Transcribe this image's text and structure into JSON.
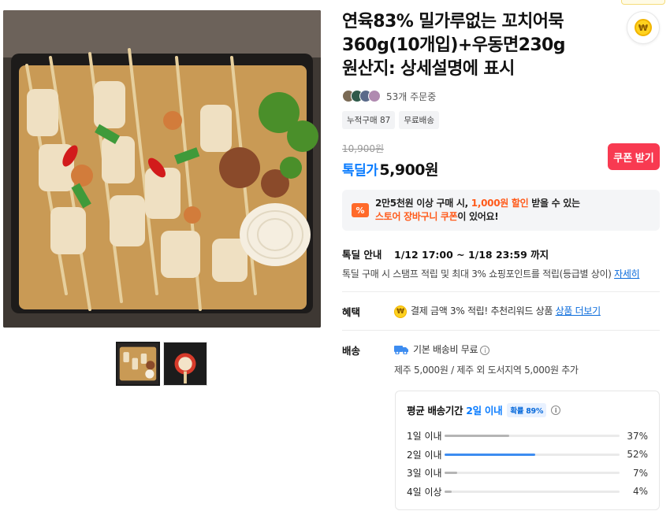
{
  "product": {
    "title": "연육83% 밀가루없는 꼬치어묵360g(10개입)+우동면230g",
    "origin": "원산지: 상세설명에 표시",
    "orders_text": "53개 주문중",
    "tags": [
      "누적구매 87",
      "무료배송"
    ]
  },
  "price": {
    "original": "10,900원",
    "deal_label": "톡딜가",
    "deal_price": "5,900원",
    "coupon_button": "쿠폰 받기"
  },
  "promo": {
    "icon_text": "%",
    "line1_pre": "2만5천원 이상 구매 시, ",
    "line1_highlight": "1,000원 할인",
    "line1_post": " 받을 수 있는",
    "line2_highlight": "스토어 장바구니 쿠폰",
    "line2_post": "이 있어요!"
  },
  "deal_info": {
    "label": "톡딜 안내",
    "period": "1/12 17:00 ~ 1/18 23:59 까지",
    "desc": "톡딜 구매 시 스탬프 적립 및 최대 3% 쇼핑포인트를 적립(등급별 상이) ",
    "link": "자세히"
  },
  "benefit": {
    "label": "혜택",
    "text": "결제 금액 3% 적립! 추천리워드 상품 ",
    "link": "상품 더보기",
    "coin": "₩"
  },
  "shipping": {
    "label": "배송",
    "base": "기본 배송비 무료",
    "extra": "제주 5,000원 / 제주 외 도서지역 5,000원 추가",
    "avg_title": "평균 배송기간",
    "avg_value": "2일 이내",
    "prob": "확률 89%",
    "rows": [
      {
        "label": "1일 이내",
        "pct": "37%",
        "value": 0.37,
        "color": "#b5b5b5"
      },
      {
        "label": "2일 이내",
        "pct": "52%",
        "value": 0.52,
        "color": "#3d8cf0"
      },
      {
        "label": "3일 이내",
        "pct": "7%",
        "value": 0.07,
        "color": "#b5b5b5"
      },
      {
        "label": "4일 이상",
        "pct": "4%",
        "value": 0.04,
        "color": "#b5b5b5"
      }
    ]
  },
  "wallet": {
    "coin": "₩"
  },
  "colors": {
    "accent_blue": "#0a7cff",
    "coupon_red": "#f83a51",
    "promo_orange": "#ff5a1a"
  }
}
